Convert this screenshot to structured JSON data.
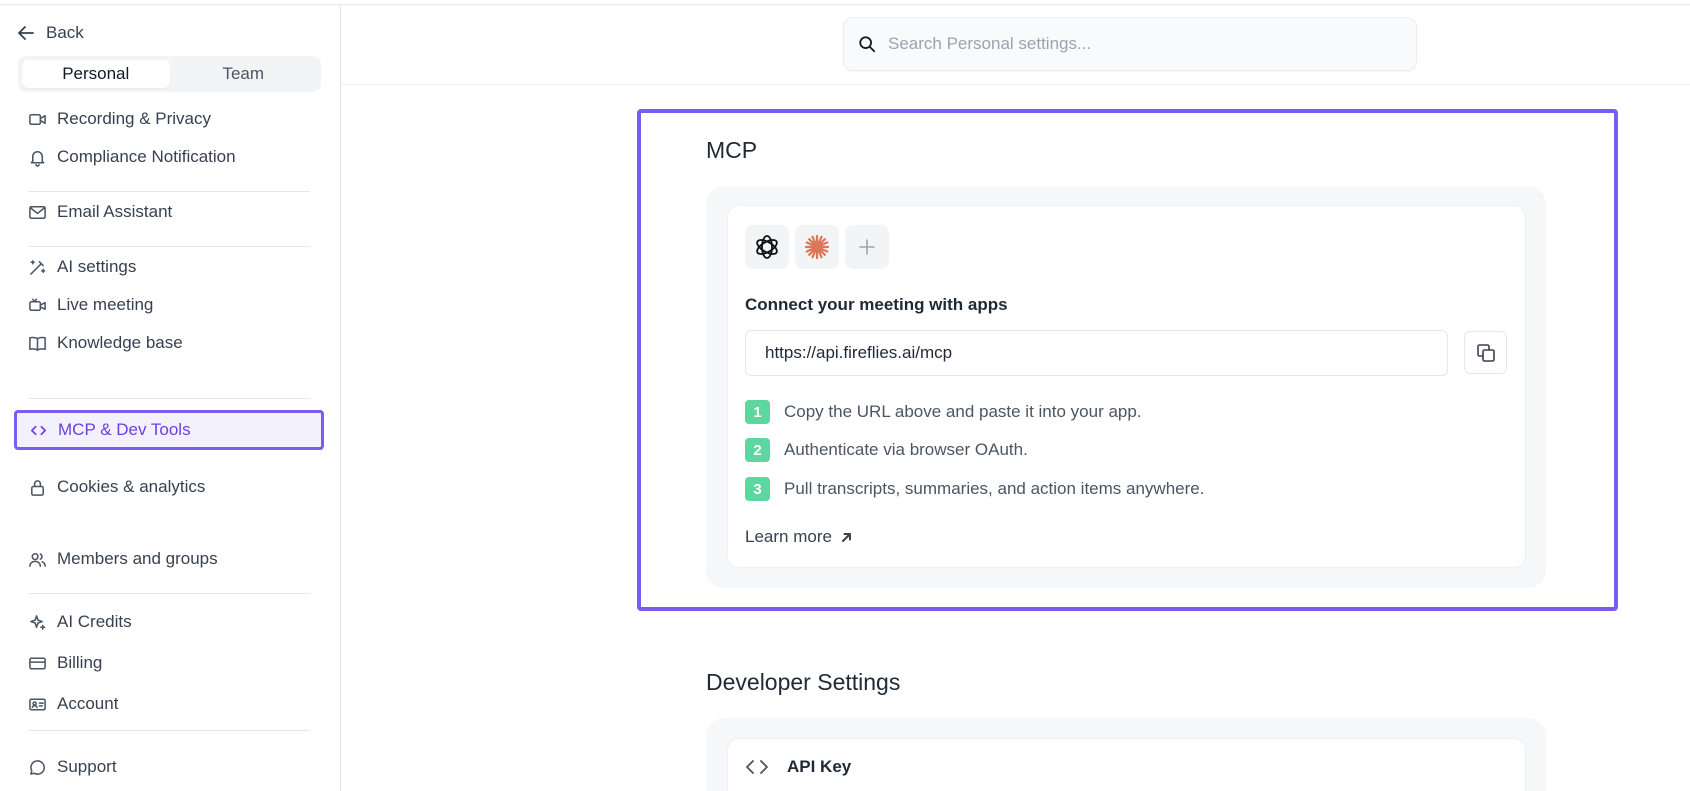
{
  "sidebar": {
    "back_label": "Back",
    "segments": [
      "Personal",
      "Team"
    ],
    "items": {
      "recording": "Recording & Privacy",
      "compliance": "Compliance Notification",
      "email": "Email Assistant",
      "ai_settings": "AI settings",
      "live_meeting": "Live meeting",
      "knowledge": "Knowledge base",
      "mcp": "MCP & Dev Tools",
      "cookies": "Cookies & analytics",
      "members": "Members and groups",
      "ai_credits": "AI Credits",
      "billing": "Billing",
      "account": "Account",
      "support": "Support"
    }
  },
  "search": {
    "placeholder": "Search Personal settings..."
  },
  "mcp": {
    "title": "MCP",
    "connect_label": "Connect your meeting with apps",
    "url": "https://api.fireflies.ai/mcp",
    "steps": [
      {
        "num": "1",
        "text": "Copy the URL above and paste it into your app."
      },
      {
        "num": "2",
        "text": "Authenticate via browser OAuth."
      },
      {
        "num": "3",
        "text": "Pull transcripts, summaries, and action items anywhere."
      }
    ],
    "learn_more": "Learn more"
  },
  "developer": {
    "title": "Developer Settings",
    "api_key_label": "API Key"
  },
  "colors": {
    "accent": "#7c5cf0",
    "step_badge": "#5ed6a0",
    "claude": "#d97757"
  }
}
